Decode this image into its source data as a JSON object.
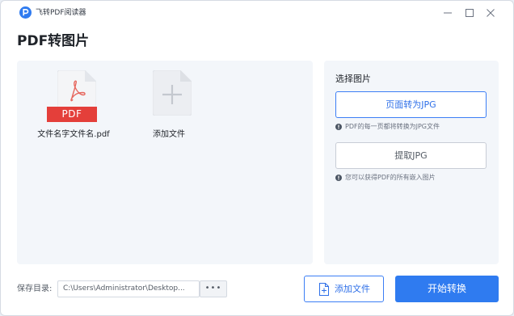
{
  "app": {
    "title": "飞转PDF阅读器",
    "logo_icon": "app-logo-icon",
    "accent": "#2f7bf0"
  },
  "window_controls": {
    "minimize_icon": "minimize-icon",
    "maximize_icon": "maximize-icon",
    "close_icon": "close-icon"
  },
  "page": {
    "title": "PDF转图片"
  },
  "files": [
    {
      "name": "文件名字文件名.pdf",
      "badge": "PDF",
      "icon": "pdf-file-icon"
    },
    {
      "name": "添加文件",
      "icon": "add-file-plus-icon"
    }
  ],
  "options": {
    "title": "选择图片",
    "items": [
      {
        "label": "页面转为JPG",
        "hint": "PDF的每一页都将转换为JPG文件",
        "selected": true
      },
      {
        "label": "提取JPG",
        "hint": "您可以获得PDF的所有嵌入图片",
        "selected": false
      }
    ]
  },
  "footer": {
    "save_label": "保存目录:",
    "save_path": "C:\\Users\\Administrator\\Desktop...",
    "browse_label": "•••",
    "add_file_label": "添加文件",
    "start_label": "开始转换"
  }
}
